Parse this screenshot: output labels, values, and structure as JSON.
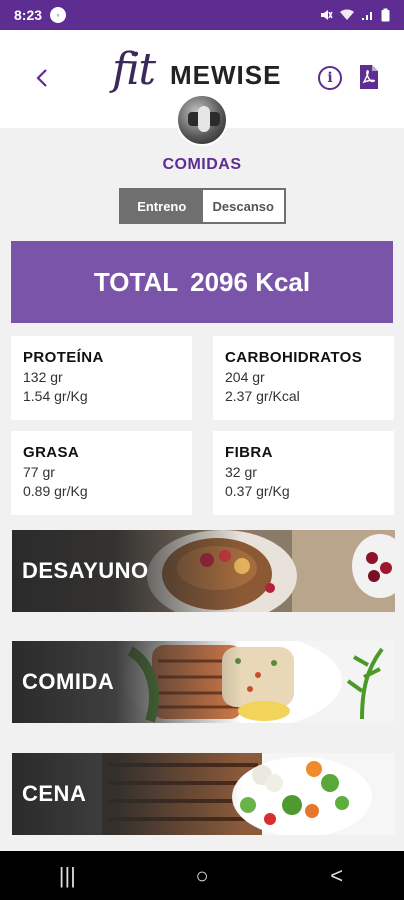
{
  "status_bar": {
    "time": "8:23",
    "notification_badge": "°"
  },
  "header": {
    "logo_script": "fit",
    "logo_brand": "MEWISE"
  },
  "page": {
    "title": "COMIDAS"
  },
  "toggle": {
    "options": [
      "Entreno",
      "Descanso"
    ],
    "selected": "Entreno"
  },
  "total": {
    "label": "TOTAL",
    "value": "2096 Kcal"
  },
  "macros": [
    {
      "title": "PROTEÍNA",
      "line1": "132 gr",
      "line2": "1.54 gr/Kg"
    },
    {
      "title": "CARBOHIDRATOS",
      "line1": "204 gr",
      "line2": "2.37 gr/Kcal"
    },
    {
      "title": "GRASA",
      "line1": "77 gr",
      "line2": "0.89 gr/Kg"
    },
    {
      "title": "FIBRA",
      "line1": "32 gr",
      "line2": "0.37 gr/Kg"
    }
  ],
  "meals": [
    {
      "label": "DESAYUNO"
    },
    {
      "label": "COMIDA"
    },
    {
      "label": "CENA"
    }
  ],
  "nav": {
    "recents": "|||",
    "home": "○",
    "back": "<"
  },
  "colors": {
    "brand_purple": "#5e2d91",
    "banner_purple": "#7a54a8"
  },
  "icons": [
    "back-icon",
    "info-icon",
    "pdf-icon",
    "mute-icon",
    "wifi-icon",
    "signal-icon",
    "battery-icon"
  ]
}
